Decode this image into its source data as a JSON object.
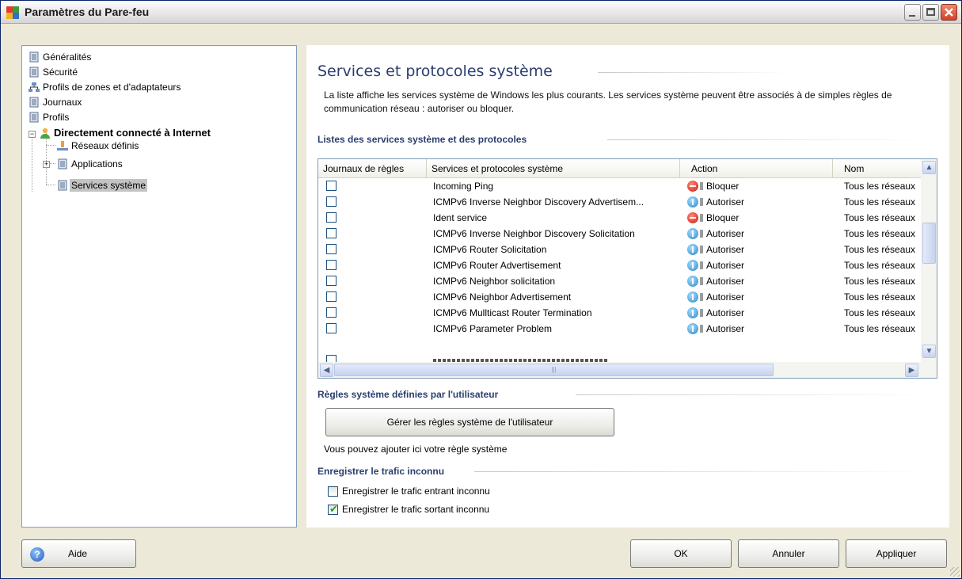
{
  "window": {
    "title": "Paramètres du Pare-feu"
  },
  "tree": {
    "items": [
      {
        "label": "Généralités",
        "icon": "document-icon"
      },
      {
        "label": "Sécurité",
        "icon": "document-icon"
      },
      {
        "label": "Profils de zones et d'adaptateurs",
        "icon": "network-icon"
      },
      {
        "label": "Journaux",
        "icon": "document-icon"
      },
      {
        "label": "Profils",
        "icon": "document-icon"
      },
      {
        "label": "Directement connecté à Internet",
        "icon": "user-icon"
      },
      {
        "label": "Réseaux définis",
        "icon": "network-icon"
      },
      {
        "label": "Applications",
        "icon": "document-icon"
      },
      {
        "label": "Services système",
        "icon": "document-icon"
      }
    ],
    "expander_minus": "−",
    "expander_plus": "+"
  },
  "main": {
    "title": "Services et protocoles système",
    "description": "La liste affiche les services système de Windows les plus courants. Les services système peuvent être associés à de simples règles de communication réseau : autoriser ou bloquer.",
    "list_section_title": "Listes des services système et des protocoles",
    "table": {
      "columns": [
        "Journaux de règles",
        "Services et protocoles système",
        "Action",
        "Nom"
      ],
      "rows": [
        {
          "log": false,
          "service": "Incoming Ping",
          "action": "Bloquer",
          "action_type": "block",
          "name": "Tous les réseaux"
        },
        {
          "log": false,
          "service": "ICMPv6 Inverse Neighbor Discovery Advertisem...",
          "action": "Autoriser",
          "action_type": "allow",
          "name": "Tous les réseaux"
        },
        {
          "log": false,
          "service": "Ident service",
          "action": "Bloquer",
          "action_type": "block",
          "name": "Tous les réseaux"
        },
        {
          "log": false,
          "service": "ICMPv6 Inverse Neighbor Discovery Solicitation",
          "action": "Autoriser",
          "action_type": "allow",
          "name": "Tous les réseaux"
        },
        {
          "log": false,
          "service": "ICMPv6 Router Solicitation",
          "action": "Autoriser",
          "action_type": "allow",
          "name": "Tous les réseaux"
        },
        {
          "log": false,
          "service": "ICMPv6 Router Advertisement",
          "action": "Autoriser",
          "action_type": "allow",
          "name": "Tous les réseaux"
        },
        {
          "log": false,
          "service": "ICMPv6 Neighbor solicitation",
          "action": "Autoriser",
          "action_type": "allow",
          "name": "Tous les réseaux"
        },
        {
          "log": false,
          "service": "ICMPv6 Neighbor Advertisement",
          "action": "Autoriser",
          "action_type": "allow",
          "name": "Tous les réseaux"
        },
        {
          "log": false,
          "service": "ICMPv6 Mullticast Router Termination",
          "action": "Autoriser",
          "action_type": "allow",
          "name": "Tous les réseaux"
        },
        {
          "log": false,
          "service": "ICMPv6 Parameter Problem",
          "action": "Autoriser",
          "action_type": "allow",
          "name": "Tous les réseaux"
        }
      ]
    },
    "user_rules_section_title": "Règles système définies par l'utilisateur",
    "manage_rules_button": "Gérer les règles système de l'utilisateur",
    "user_rules_hint": "Vous pouvez ajouter ici votre règle système",
    "unknown_traffic_section_title": "Enregistrer le trafic inconnu",
    "log_incoming_label": "Enregistrer le trafic entrant inconnu",
    "log_incoming_checked": false,
    "log_outgoing_label": "Enregistrer le trafic sortant inconnu",
    "log_outgoing_checked": true
  },
  "footer": {
    "help_button": "Aide",
    "ok_button": "OK",
    "cancel_button": "Annuler",
    "apply_button": "Appliquer"
  },
  "scroll": {
    "up": "▲",
    "down": "▼",
    "left": "◀",
    "right": "▶",
    "grip": "|||"
  },
  "colors": {
    "section_title": "#2a3e6e",
    "selection": "#c3c3c3",
    "window_bg": "#ece9d8"
  }
}
